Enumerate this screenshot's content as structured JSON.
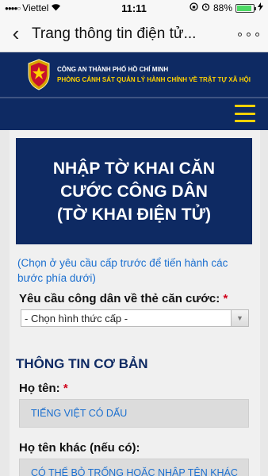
{
  "status_bar": {
    "signal": "●●●●○",
    "carrier": "Viettel",
    "time": "11:11",
    "battery_pct": "88%",
    "battery_level": 0.88
  },
  "nav": {
    "back_icon": "‹",
    "title": "Trang thông tin điện tử...",
    "more_icon": "∘∘∘"
  },
  "header": {
    "org_name": "CÔNG AN THÀNH PHỐ HỒ CHÍ MINH",
    "dept_name": "PHÒNG CẢNH SÁT QUẢN LÝ HÀNH CHÍNH VỀ TRẬT TỰ XÃ HỘI"
  },
  "page_title": {
    "line1": "NHẬP TỜ KHAI CĂN",
    "line2": "CƯỚC CÔNG DÂN",
    "line3": "(TỜ KHAI ĐIỆN TỬ)"
  },
  "hint": "(Chọn ở yêu cầu cấp trước để tiến hành các bước phía dưới)",
  "form": {
    "request_label": "Yêu cầu công dân về thẻ căn cước:",
    "required_mark": "*",
    "request_select": "- Chọn hình thức cấp -",
    "section_basic": "THÔNG TIN CƠ BẢN",
    "name_label": "Họ tên:",
    "name_placeholder": "TIẾNG VIỆT CÓ DẤU",
    "other_name_label": "Họ tên khác (nếu có):",
    "other_name_placeholder": "CÓ THỂ BỎ TRỐNG HOẶC NHẬP TÊN KHÁC"
  },
  "colors": {
    "brand_navy": "#0e2a63",
    "accent_yellow": "#ffd200",
    "link_blue": "#1b6fcf",
    "required_red": "#d0021b"
  }
}
